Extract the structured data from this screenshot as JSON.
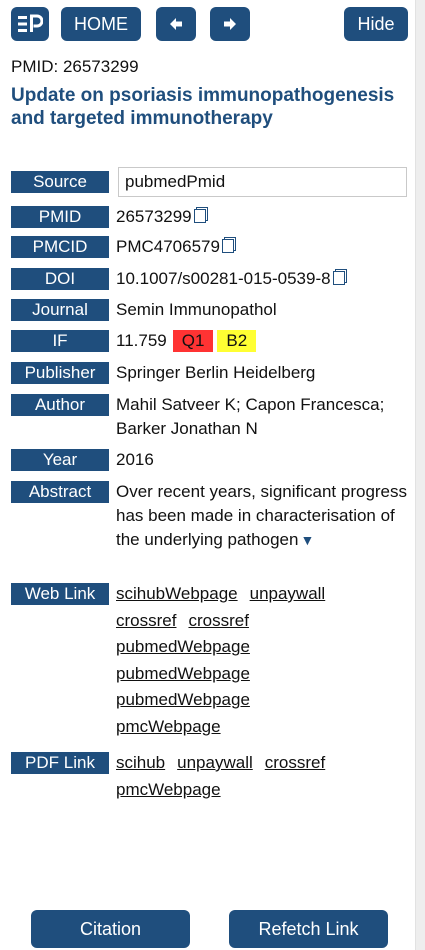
{
  "toolbar": {
    "logo_label": "EP",
    "home_label": "HOME",
    "hide_label": "Hide",
    "back_icon": "arrow-left-icon",
    "forward_icon": "arrow-right-icon"
  },
  "header": {
    "pmid_line": "PMID: 26573299",
    "title": "Update on psoriasis immunopathogenesis and targeted immunotherapy"
  },
  "fields": {
    "source": {
      "label": "Source",
      "value": "pubmedPmid"
    },
    "pmid": {
      "label": "PMID",
      "value": "26573299"
    },
    "pmcid": {
      "label": "PMCID",
      "value": "PMC4706579"
    },
    "doi": {
      "label": "DOI",
      "value": "10.1007/s00281-015-0539-8"
    },
    "journal": {
      "label": "Journal",
      "value": "Semin Immunopathol"
    },
    "if": {
      "label": "IF",
      "value": "11.759",
      "quartile": "Q1",
      "grade": "B2"
    },
    "publisher": {
      "label": "Publisher",
      "value": "Springer Berlin Heidelberg"
    },
    "author": {
      "label": "Author",
      "value": "Mahil Satveer K; Capon Francesca; Barker Jonathan N"
    },
    "year": {
      "label": "Year",
      "value": "2016"
    },
    "abstract": {
      "label": "Abstract",
      "value": "Over recent years, significant progress has been made in characterisation of the underlying pathogen",
      "expand_glyph": "▼"
    },
    "web_link": {
      "label": "Web Link",
      "links": [
        "scihubWebpage",
        "unpaywall",
        "crossref",
        "crossref",
        "pubmedWebpage",
        "pubmedWebpage",
        "pubmedWebpage",
        "pmcWebpage"
      ]
    },
    "pdf_link": {
      "label": "PDF Link",
      "links": [
        "scihub",
        "unpaywall",
        "crossref",
        "pmcWebpage"
      ]
    }
  },
  "footer": {
    "citation_label": "Citation",
    "refetch_label": "Refetch Link"
  },
  "colors": {
    "primary": "#1f4e7d",
    "q1_badge": "#ff3333",
    "b2_badge": "#ffff33"
  }
}
